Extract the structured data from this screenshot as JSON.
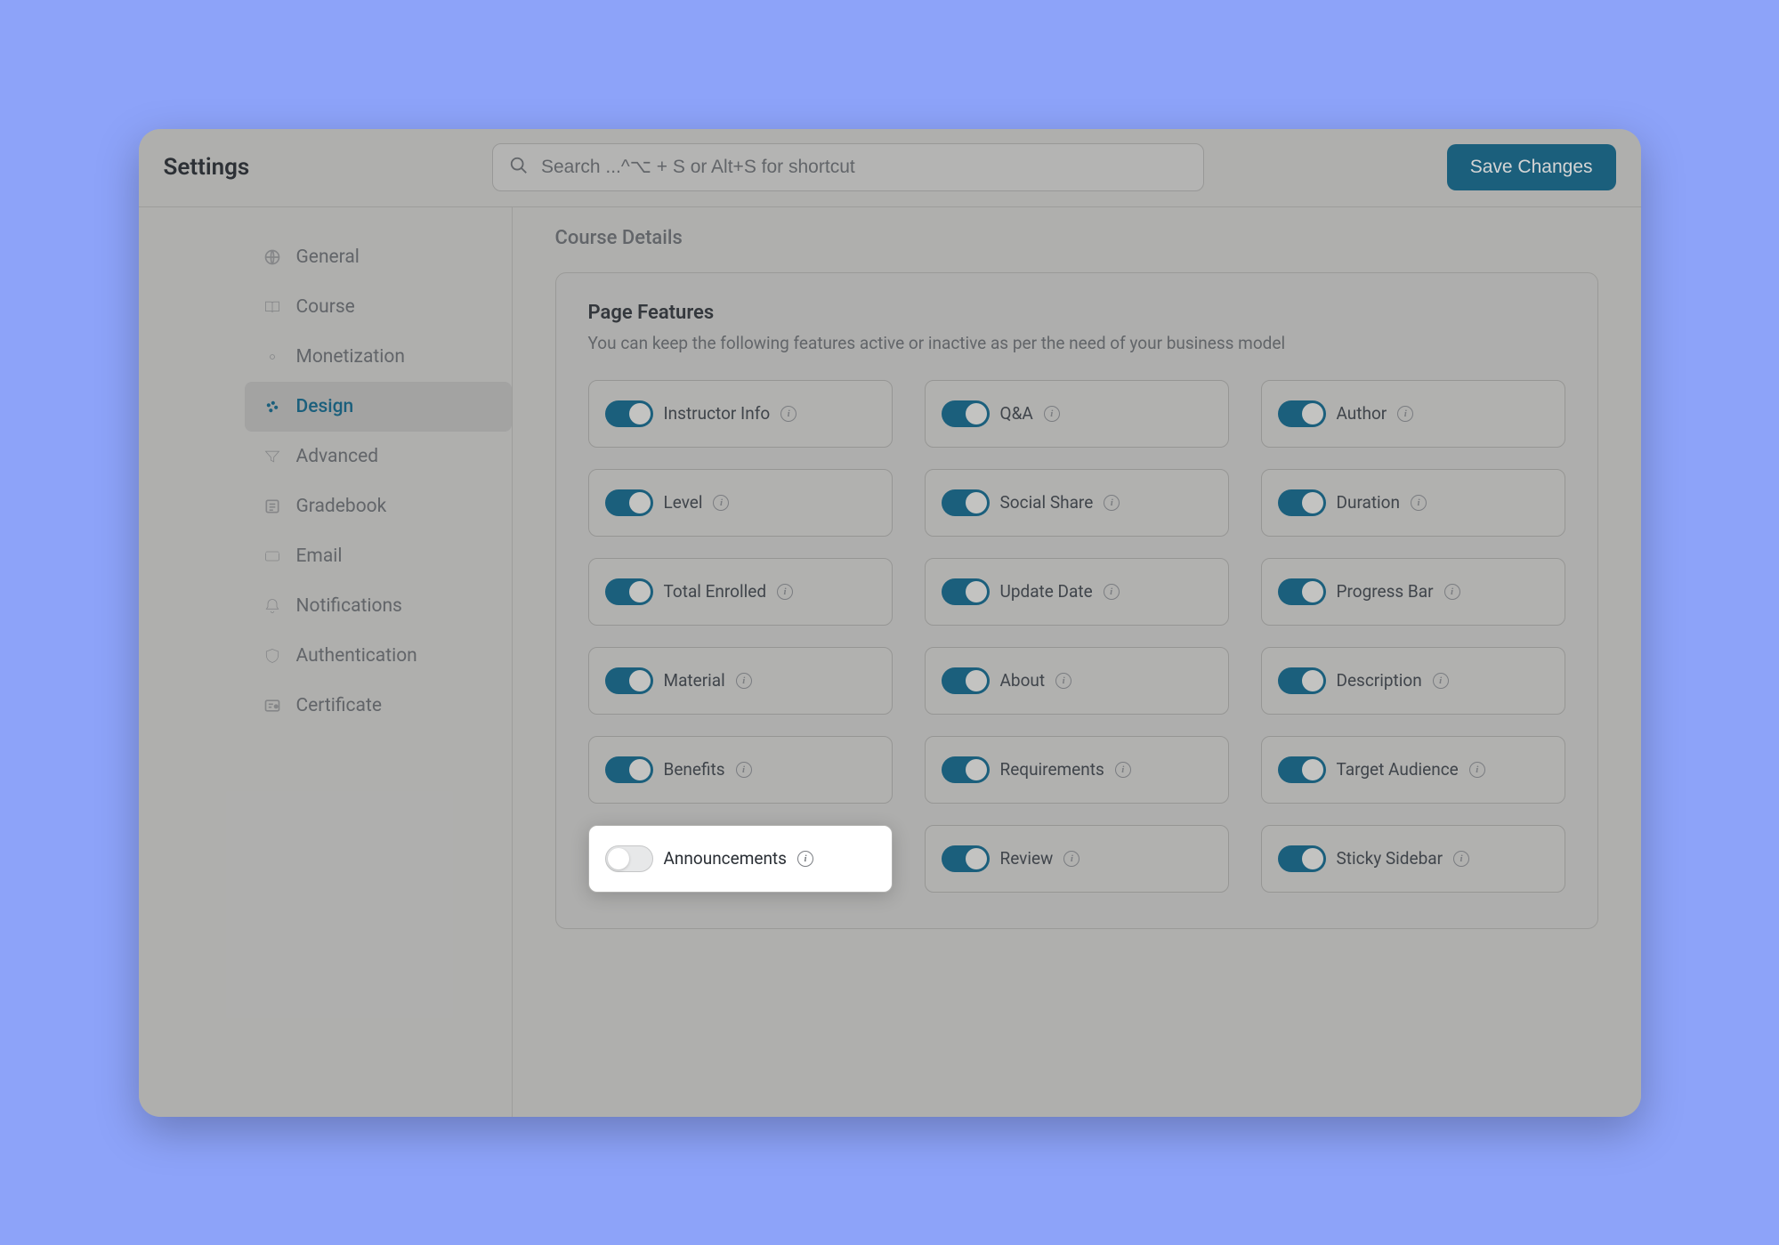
{
  "header": {
    "title": "Settings",
    "search_placeholder": "Search ...^⌥ + S or Alt+S for shortcut",
    "save_label": "Save Changes"
  },
  "sidebar": {
    "items": [
      {
        "label": "General",
        "icon": "globe-icon",
        "active": false
      },
      {
        "label": "Course",
        "icon": "book-icon",
        "active": false
      },
      {
        "label": "Monetization",
        "icon": "money-icon",
        "active": false
      },
      {
        "label": "Design",
        "icon": "palette-icon",
        "active": true
      },
      {
        "label": "Advanced",
        "icon": "filter-icon",
        "active": false
      },
      {
        "label": "Gradebook",
        "icon": "grade-icon",
        "active": false
      },
      {
        "label": "Email",
        "icon": "mail-icon",
        "active": false
      },
      {
        "label": "Notifications",
        "icon": "bell-icon",
        "active": false
      },
      {
        "label": "Authentication",
        "icon": "shield-icon",
        "active": false
      },
      {
        "label": "Certificate",
        "icon": "certificate-icon",
        "active": false
      }
    ]
  },
  "main": {
    "section_title": "Course Details",
    "panel": {
      "title": "Page Features",
      "subtitle": "You can keep the following features active or inactive as per the need of your business model",
      "features": [
        {
          "label": "Instructor Info",
          "on": true,
          "highlight": false
        },
        {
          "label": "Q&A",
          "on": true,
          "highlight": false
        },
        {
          "label": "Author",
          "on": true,
          "highlight": false
        },
        {
          "label": "Level",
          "on": true,
          "highlight": false
        },
        {
          "label": "Social Share",
          "on": true,
          "highlight": false
        },
        {
          "label": "Duration",
          "on": true,
          "highlight": false
        },
        {
          "label": "Total Enrolled",
          "on": true,
          "highlight": false
        },
        {
          "label": "Update Date",
          "on": true,
          "highlight": false
        },
        {
          "label": "Progress Bar",
          "on": true,
          "highlight": false
        },
        {
          "label": "Material",
          "on": true,
          "highlight": false
        },
        {
          "label": "About",
          "on": true,
          "highlight": false
        },
        {
          "label": "Description",
          "on": true,
          "highlight": false
        },
        {
          "label": "Benefits",
          "on": true,
          "highlight": false
        },
        {
          "label": "Requirements",
          "on": true,
          "highlight": false
        },
        {
          "label": "Target Audience",
          "on": true,
          "highlight": false
        },
        {
          "label": "Announcements",
          "on": false,
          "highlight": true
        },
        {
          "label": "Review",
          "on": true,
          "highlight": false
        },
        {
          "label": "Sticky Sidebar",
          "on": true,
          "highlight": false
        }
      ]
    }
  }
}
